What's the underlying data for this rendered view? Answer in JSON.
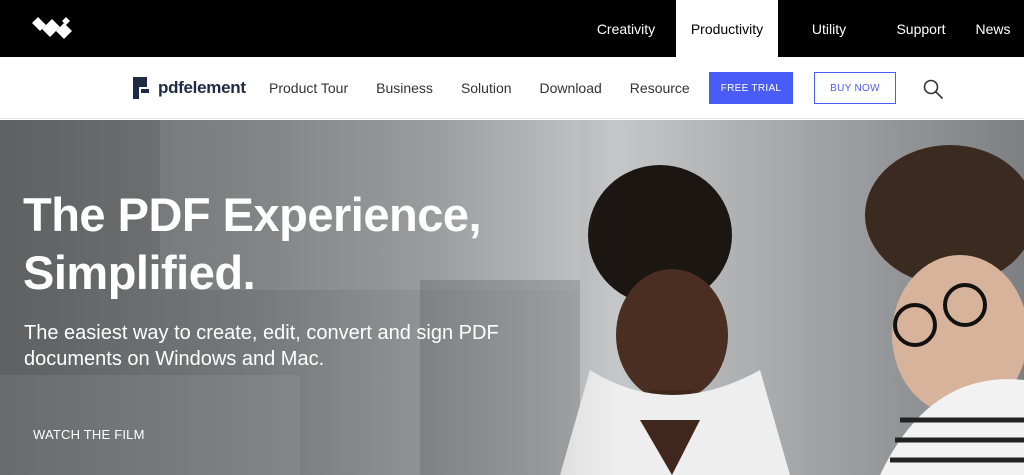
{
  "topbar": {
    "logo_icon": "wondershare-logo",
    "nav": [
      {
        "label": "Creativity",
        "active": false
      },
      {
        "label": "Productivity",
        "active": true
      },
      {
        "label": "Utility",
        "active": false
      },
      {
        "label": "Support",
        "active": false
      },
      {
        "label": "News",
        "active": false
      }
    ]
  },
  "subnav": {
    "brand": "pdfelement",
    "brand_icon": "pdfelement-logo",
    "links": [
      "Product Tour",
      "Business",
      "Solution",
      "Download",
      "Resource"
    ],
    "free_trial": "FREE TRIAL",
    "buy_now": "BUY NOW",
    "search_icon": "search-icon",
    "accent_color": "#4a5cf7"
  },
  "hero": {
    "headline_line1": "The PDF Experience,",
    "headline_line2": "Simplified.",
    "subhead": "The easiest way to create, edit, convert and sign PDF documents on Windows and Mac.",
    "watch_label": "WATCH THE FILM"
  }
}
